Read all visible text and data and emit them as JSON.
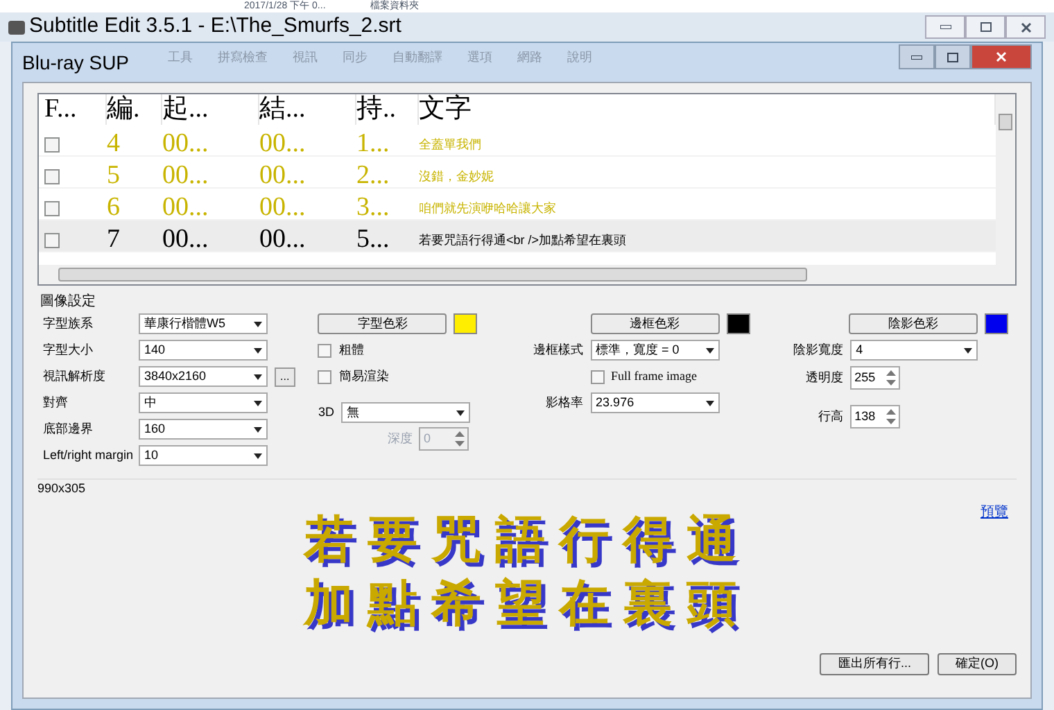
{
  "background_strip": {
    "date": "2017/1/28 下午 0...",
    "type": "檔案資料夾"
  },
  "window": {
    "title": "Subtitle Edit 3.5.1 - E:\\The_Smurfs_2.srt"
  },
  "background_menu": [
    "工具",
    "拼寫檢查",
    "視訊",
    "同步",
    "自動翻譯",
    "選項",
    "網路",
    "說明"
  ],
  "dialog": {
    "title": "Blu-ray SUP",
    "list": {
      "columns": [
        "F...",
        "編.",
        "起...",
        "結...",
        "持..",
        "文字"
      ],
      "rows": [
        {
          "checked": false,
          "selected": false,
          "color": "#c8b400",
          "number": "4",
          "start": "00...",
          "end": "00...",
          "duration": "1...",
          "text": "全蓋單我們"
        },
        {
          "checked": false,
          "selected": false,
          "color": "#c8b400",
          "number": "5",
          "start": "00...",
          "end": "00...",
          "duration": "2...",
          "text": "沒錯，金妙妮"
        },
        {
          "checked": false,
          "selected": false,
          "color": "#c8b400",
          "number": "6",
          "start": "00...",
          "end": "00...",
          "duration": "3...",
          "text": "咱們就先演咿哈哈讓大家"
        },
        {
          "checked": false,
          "selected": true,
          "color": "#000000",
          "number": "7",
          "start": "00...",
          "end": "00...",
          "duration": "5...",
          "text": "若要咒語行得通<br />加點希望在裏頭"
        }
      ]
    },
    "settings": {
      "title": "圖像設定",
      "columns": [
        [
          {
            "kind": "dropdown",
            "label": "字型族系",
            "value": "華康行楷體W5"
          },
          {
            "kind": "dropdown",
            "label": "字型大小",
            "value": "140"
          },
          {
            "kind": "dropdown",
            "label": "視訊解析度",
            "value": "3840x2160",
            "button": "..."
          },
          {
            "kind": "dropdown",
            "label": "對齊",
            "value": "中"
          },
          {
            "kind": "dropdown",
            "label": "底部邊界",
            "value": "160"
          },
          {
            "kind": "dropdown",
            "label": "Left/right margin",
            "value": "10"
          }
        ],
        [
          {
            "kind": "color_button",
            "label": "字型色彩",
            "color": "#ffee00"
          },
          {
            "kind": "checkbox",
            "label": "粗體",
            "checked": false
          },
          {
            "kind": "checkbox",
            "label": "簡易渲染",
            "checked": false
          },
          {
            "kind": "dropdown",
            "label": "3D",
            "value": "無"
          },
          {
            "kind": "spinner",
            "label": "深度",
            "value": "0",
            "disabled": true
          }
        ],
        [
          {
            "kind": "color_button",
            "label": "邊框色彩",
            "color": "#000000"
          },
          {
            "kind": "dropdown",
            "label": "邊框樣式",
            "value": "標準，寬度 = 0"
          },
          {
            "kind": "checkbox",
            "label": "Full frame image",
            "checked": false
          },
          {
            "kind": "dropdown",
            "label": "影格率",
            "value": "23.976"
          }
        ],
        [
          {
            "kind": "color_button",
            "label": "陰影色彩",
            "color": "#0000ee"
          },
          {
            "kind": "dropdown",
            "label": "陰影寬度",
            "value": "4"
          },
          {
            "kind": "spinner",
            "label": "透明度",
            "value": "255",
            "disabled": false
          },
          {
            "kind": "spinner",
            "label": "行高",
            "value": "138",
            "disabled": false
          }
        ]
      ]
    },
    "preview": {
      "size": "990x305",
      "link": "預覽",
      "lines": [
        "若要咒語行得通",
        "加點希望在裏頭"
      ]
    },
    "footer_buttons": [
      "匯出所有行...",
      "確定(O)"
    ]
  }
}
